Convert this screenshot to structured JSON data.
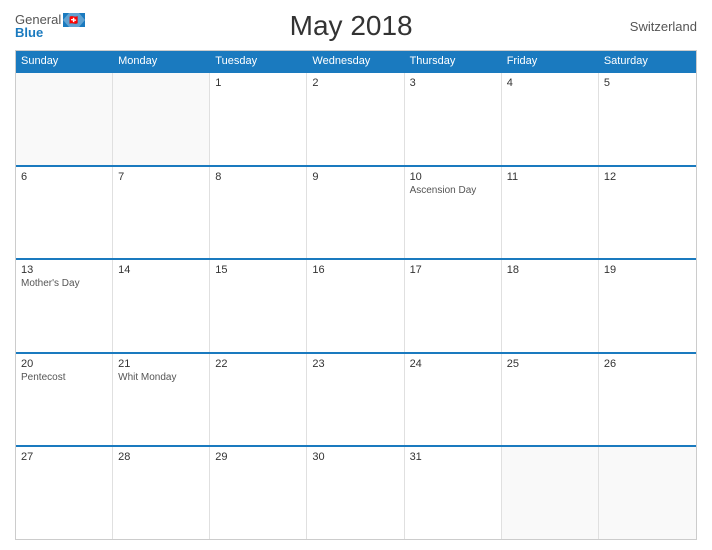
{
  "logo": {
    "general": "General",
    "blue": "Blue"
  },
  "title": "May 2018",
  "country": "Switzerland",
  "calendar": {
    "headers": [
      "Sunday",
      "Monday",
      "Tuesday",
      "Wednesday",
      "Thursday",
      "Friday",
      "Saturday"
    ],
    "weeks": [
      [
        {
          "day": "",
          "event": ""
        },
        {
          "day": "",
          "event": ""
        },
        {
          "day": "1",
          "event": ""
        },
        {
          "day": "2",
          "event": ""
        },
        {
          "day": "3",
          "event": ""
        },
        {
          "day": "4",
          "event": ""
        },
        {
          "day": "5",
          "event": ""
        }
      ],
      [
        {
          "day": "6",
          "event": ""
        },
        {
          "day": "7",
          "event": ""
        },
        {
          "day": "8",
          "event": ""
        },
        {
          "day": "9",
          "event": ""
        },
        {
          "day": "10",
          "event": "Ascension Day"
        },
        {
          "day": "11",
          "event": ""
        },
        {
          "day": "12",
          "event": ""
        }
      ],
      [
        {
          "day": "13",
          "event": "Mother's Day"
        },
        {
          "day": "14",
          "event": ""
        },
        {
          "day": "15",
          "event": ""
        },
        {
          "day": "16",
          "event": ""
        },
        {
          "day": "17",
          "event": ""
        },
        {
          "day": "18",
          "event": ""
        },
        {
          "day": "19",
          "event": ""
        }
      ],
      [
        {
          "day": "20",
          "event": "Pentecost"
        },
        {
          "day": "21",
          "event": "Whit Monday"
        },
        {
          "day": "22",
          "event": ""
        },
        {
          "day": "23",
          "event": ""
        },
        {
          "day": "24",
          "event": ""
        },
        {
          "day": "25",
          "event": ""
        },
        {
          "day": "26",
          "event": ""
        }
      ],
      [
        {
          "day": "27",
          "event": ""
        },
        {
          "day": "28",
          "event": ""
        },
        {
          "day": "29",
          "event": ""
        },
        {
          "day": "30",
          "event": ""
        },
        {
          "day": "31",
          "event": ""
        },
        {
          "day": "",
          "event": ""
        },
        {
          "day": "",
          "event": ""
        }
      ]
    ]
  }
}
